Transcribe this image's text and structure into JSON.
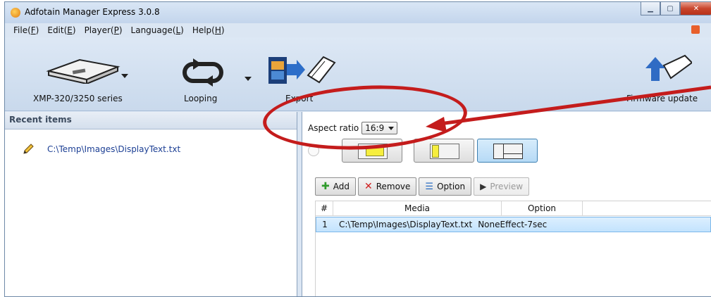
{
  "window": {
    "title": "Adfotain Manager Express 3.0.8"
  },
  "menu": [
    {
      "text": "File(",
      "key": "F",
      "end": ")"
    },
    {
      "text": "Edit(",
      "key": "E",
      "end": ")"
    },
    {
      "text": "Player(",
      "key": "P",
      "end": ")"
    },
    {
      "text": "Language(",
      "key": "L",
      "end": ")"
    },
    {
      "text": "Help(",
      "key": "H",
      "end": ")"
    }
  ],
  "toolbar": {
    "device_label": "XMP-320/3250 series",
    "looping_label": "Looping",
    "export_label": "Export",
    "firmware_label": "Firmware update"
  },
  "recent": {
    "header": "Recent items",
    "items": [
      "C:\\Temp\\Images\\DisplayText.txt"
    ]
  },
  "aspect": {
    "label": "Aspect ratio",
    "value": "16:9"
  },
  "buttons": {
    "add": "Add",
    "remove": "Remove",
    "option": "Option",
    "preview": "Preview"
  },
  "table": {
    "headers": [
      "#",
      "Media",
      "Option"
    ],
    "rows": [
      {
        "num": "1",
        "media": "C:\\Temp\\Images\\DisplayText.txt",
        "option": "NoneEffect-7sec"
      }
    ]
  },
  "colors": {
    "annotation": "#c41c1c",
    "accent": "#3c7fb1"
  }
}
